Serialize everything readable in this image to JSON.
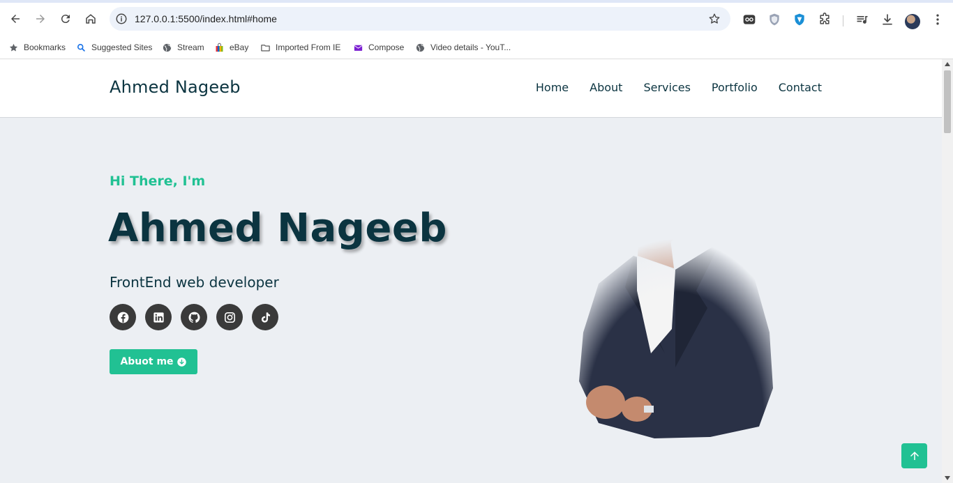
{
  "browser": {
    "url": "127.0.0.1:5500/index.html#home",
    "bookmarks": [
      {
        "label": "Bookmarks",
        "icon": "star-icon"
      },
      {
        "label": "Suggested Sites",
        "icon": "search-icon"
      },
      {
        "label": "Stream",
        "icon": "globe-icon"
      },
      {
        "label": "eBay",
        "icon": "shopping-bag-icon"
      },
      {
        "label": "Imported From IE",
        "icon": "folder-icon"
      },
      {
        "label": "Compose",
        "icon": "mail-icon"
      },
      {
        "label": "Video details - YouT...",
        "icon": "globe-icon"
      }
    ]
  },
  "site": {
    "logo": "Ahmed Nageeb",
    "menu": [
      "Home",
      "About",
      "Services",
      "Portfolio",
      "Contact"
    ]
  },
  "hero": {
    "greeting": "Hi There, I'm",
    "name": "Ahmed Nageeb",
    "role": "FrontEnd web developer",
    "socials": [
      "facebook-icon",
      "linkedin-icon",
      "github-icon",
      "instagram-icon",
      "tiktok-icon"
    ],
    "cta_label": "Abuot me"
  },
  "colors": {
    "accent": "#21c193",
    "dark": "#0b3440",
    "hero_bg": "#eceff3",
    "social_bg": "#3a3a3a"
  }
}
